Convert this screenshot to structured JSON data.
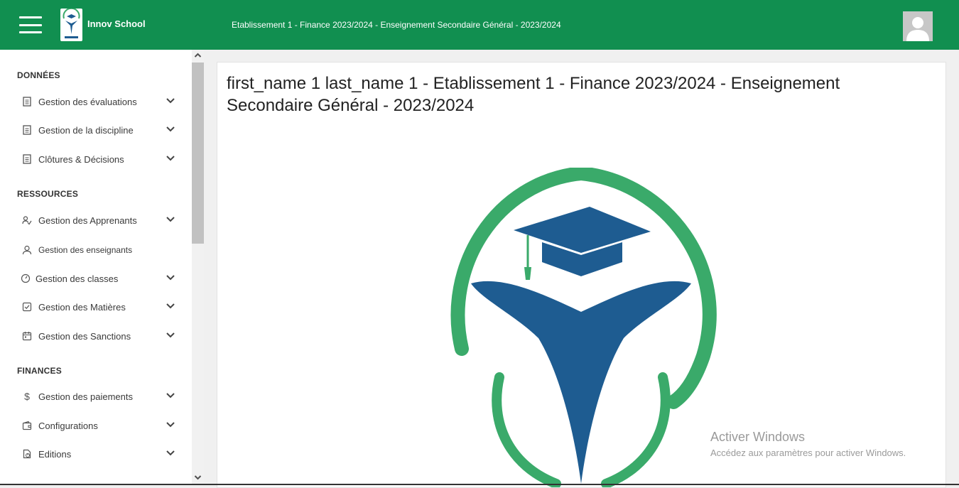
{
  "app": {
    "name": "Innov School"
  },
  "header": {
    "title": "Etablissement 1 - Finance 2023/2024 - Enseignement Secondaire Général - 2023/2024"
  },
  "sidebar": {
    "sections": [
      {
        "title": "DONNÉES"
      },
      {
        "title": "RESSOURCES"
      },
      {
        "title": "FINANCES"
      }
    ],
    "items": [
      {
        "label": "Gestion des évaluations",
        "icon": "document-icon"
      },
      {
        "label": "Gestion de la discipline",
        "icon": "document-icon"
      },
      {
        "label": "Clôtures & Décisions",
        "icon": "document-icon"
      },
      {
        "label": "Gestion des Apprenants",
        "icon": "users-icon"
      },
      {
        "label": "Gestion des enseignants",
        "icon": "user-icon"
      },
      {
        "label": "Gestion des classes",
        "icon": "gauge-icon"
      },
      {
        "label": "Gestion des Matières",
        "icon": "checkbox-icon"
      },
      {
        "label": "Gestion des Sanctions",
        "icon": "calendar-icon"
      },
      {
        "label": "Gestion des paiements",
        "icon": "dollar-icon"
      },
      {
        "label": "Configurations",
        "icon": "wallet-icon"
      },
      {
        "label": "Editions",
        "icon": "file-chart-icon"
      }
    ]
  },
  "main": {
    "title": "first_name 1 last_name 1 - Etablissement 1 - Finance 2023/2024 - Enseignement Secondaire Général - 2023/2024"
  },
  "watermark": {
    "title": "Activer Windows",
    "subtitle": "Accédez aux paramètres pour activer Windows."
  },
  "colors": {
    "header_bg": "#118f50",
    "logo_green": "#3aaa6a",
    "logo_blue": "#1e5c91"
  }
}
